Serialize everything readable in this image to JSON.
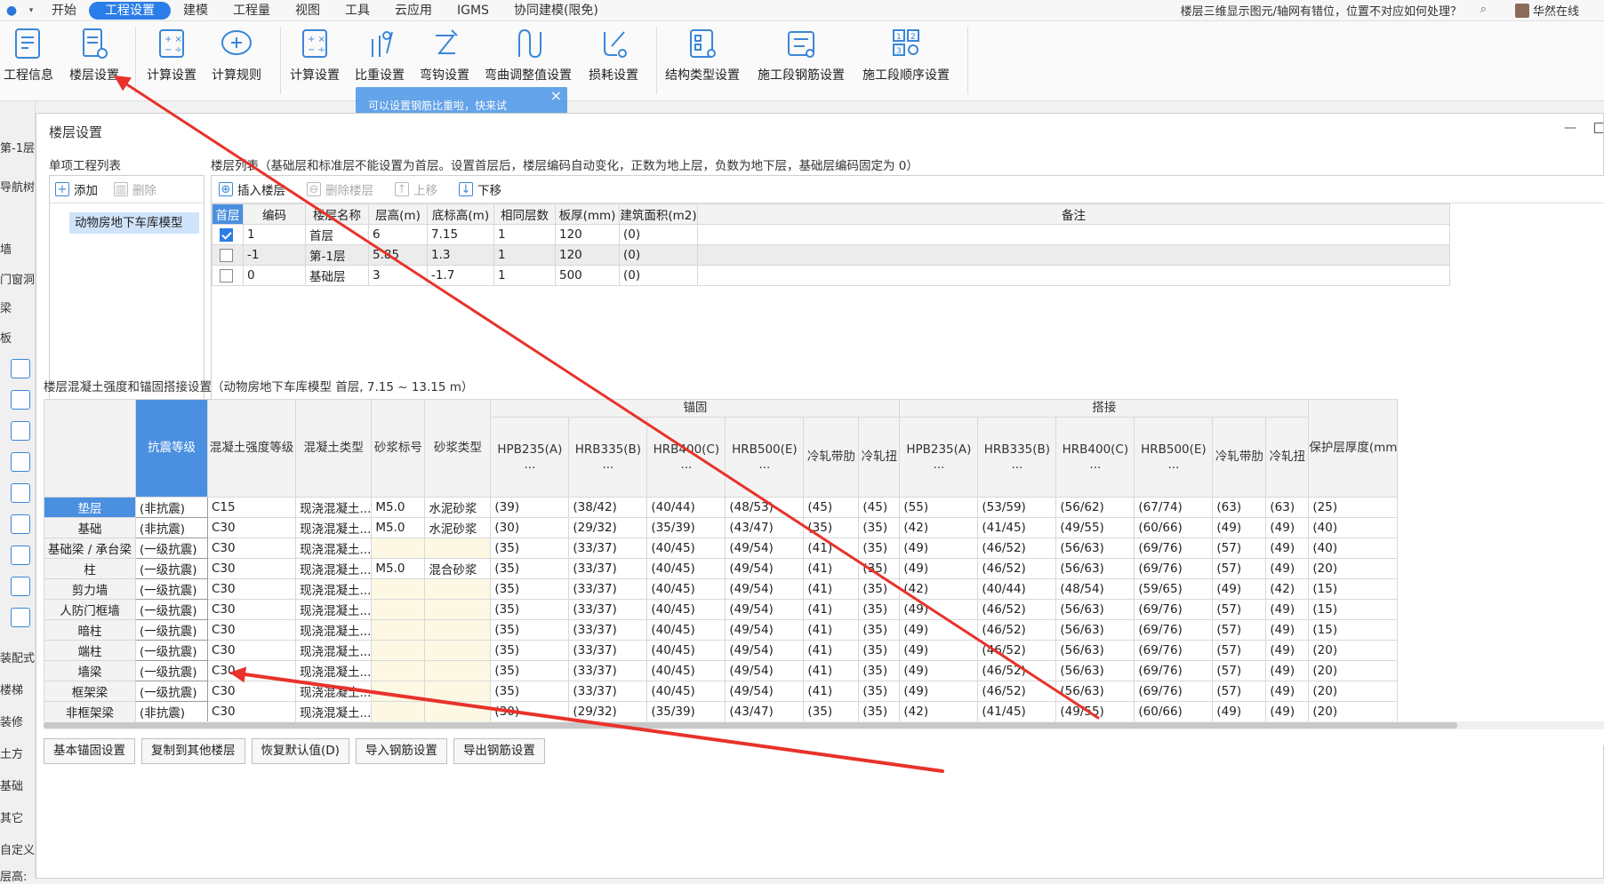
{
  "menu": {
    "items": [
      "开始",
      "工程设置",
      "建模",
      "工程量",
      "视图",
      "工具",
      "云应用",
      "IGMS",
      "协同建模(限免)"
    ],
    "active_index": 1,
    "help_text": "楼层三维显示图元/轴网有错位，位置不对应如何处理？",
    "user": "华然在线"
  },
  "ribbon": {
    "buttons": [
      "工程信息",
      "楼层设置",
      "计算设置",
      "计算规则",
      "计算设置",
      "比重设置",
      "弯钩设置",
      "弯曲调整值设置",
      "损耗设置",
      "结构类型设置",
      "施工段钢筋设置",
      "施工段顺序设置"
    ],
    "tooltip": "可以设置钢筋比重啦，快来试"
  },
  "leftnav": [
    "第-1层",
    "导航树",
    "墙",
    "门窗洞",
    "梁",
    "板",
    "装配式",
    "楼梯",
    "装修",
    "土方",
    "基础",
    "其它",
    "自定义",
    "层高:"
  ],
  "dialog": {
    "title": "楼层设置",
    "project_list_label": "单项工程列表",
    "project_toolbar": [
      "添加",
      "删除"
    ],
    "projects": [
      "动物房地下车库模型"
    ],
    "floor_list_label": "楼层列表（基础层和标准层不能设置为首层。设置首层后，楼层编码自动变化，正数为地上层，负数为地下层，基础层编码固定为 0）",
    "floor_toolbar": [
      "插入楼层",
      "删除楼层",
      "上移",
      "下移"
    ],
    "floor_columns": [
      "首层",
      "编码",
      "楼层名称",
      "层高(m)",
      "底标高(m)",
      "相同层数",
      "板厚(mm)",
      "建筑面积(m2)",
      "备注"
    ],
    "floors": [
      {
        "first": true,
        "code": "1",
        "name": "首层",
        "height": "6",
        "bottom": "7.15",
        "same": "1",
        "thick": "120",
        "area": "(0)",
        "note": ""
      },
      {
        "first": false,
        "code": "-1",
        "name": "第-1层",
        "height": "5.85",
        "bottom": "1.3",
        "same": "1",
        "thick": "120",
        "area": "(0)",
        "note": ""
      },
      {
        "first": false,
        "code": "0",
        "name": "基础层",
        "height": "3",
        "bottom": "-1.7",
        "same": "1",
        "thick": "500",
        "area": "(0)",
        "note": ""
      }
    ],
    "concrete_label": "楼层混凝土强度和锚固搭接设置（动物房地下车库模型 首层, 7.15 ~ 13.15 m）",
    "concrete_headers": {
      "grade": "抗震等级",
      "strength": "混凝土强度等级",
      "ctype": "混凝土类型",
      "mortar_mark": "砂浆标号",
      "mortar_type": "砂浆类型",
      "anchor_group": "锚固",
      "lap_group": "搭接",
      "anchor_cols": [
        "HPB235(A)\n...",
        "HRB335(B)\n...",
        "HRB400(C)\n...",
        "HRB500(E)\n...",
        "冷轧带肋",
        "冷轧扭"
      ],
      "lap_cols": [
        "HPB235(A)\n...",
        "HRB335(B)\n...",
        "HRB400(C)\n...",
        "HRB500(E)\n...",
        "冷轧带肋",
        "冷轧扭"
      ],
      "cover": "保护层厚度(mm"
    },
    "concrete_rows": [
      {
        "name": "垫层",
        "grade": "(非抗震)",
        "strength": "C15",
        "ctype": "现浇混凝土...",
        "mm": "M5.0",
        "mt": "水泥砂浆",
        "anchor": [
          "(39)",
          "(38/42)",
          "(40/44)",
          "(48/53)",
          "(45)",
          "(45)"
        ],
        "lap": [
          "(55)",
          "(53/59)",
          "(56/62)",
          "(67/74)",
          "(63)",
          "(63)"
        ],
        "cover": "(25)"
      },
      {
        "name": "基础",
        "grade": "(非抗震)",
        "strength": "C30",
        "ctype": "现浇混凝土...",
        "mm": "M5.0",
        "mt": "水泥砂浆",
        "anchor": [
          "(30)",
          "(29/32)",
          "(35/39)",
          "(43/47)",
          "(35)",
          "(35)"
        ],
        "lap": [
          "(42)",
          "(41/45)",
          "(49/55)",
          "(60/66)",
          "(49)",
          "(49)"
        ],
        "cover": "(40)"
      },
      {
        "name": "基础梁 / 承台梁",
        "grade": "(一级抗震)",
        "strength": "C30",
        "ctype": "现浇混凝土...",
        "mm": "",
        "mt": "",
        "anchor": [
          "(35)",
          "(33/37)",
          "(40/45)",
          "(49/54)",
          "(41)",
          "(35)"
        ],
        "lap": [
          "(49)",
          "(46/52)",
          "(56/63)",
          "(69/76)",
          "(57)",
          "(49)"
        ],
        "cover": "(40)"
      },
      {
        "name": "柱",
        "grade": "(一级抗震)",
        "strength": "C30",
        "ctype": "现浇混凝土...",
        "mm": "M5.0",
        "mt": "混合砂浆",
        "anchor": [
          "(35)",
          "(33/37)",
          "(40/45)",
          "(49/54)",
          "(41)",
          "(35)"
        ],
        "lap": [
          "(49)",
          "(46/52)",
          "(56/63)",
          "(69/76)",
          "(57)",
          "(49)"
        ],
        "cover": "(20)"
      },
      {
        "name": "剪力墙",
        "grade": "(一级抗震)",
        "strength": "C30",
        "ctype": "现浇混凝土...",
        "mm": "",
        "mt": "",
        "anchor": [
          "(35)",
          "(33/37)",
          "(40/45)",
          "(49/54)",
          "(41)",
          "(35)"
        ],
        "lap": [
          "(42)",
          "(40/44)",
          "(48/54)",
          "(59/65)",
          "(49)",
          "(42)"
        ],
        "cover": "(15)"
      },
      {
        "name": "人防门框墙",
        "grade": "(一级抗震)",
        "strength": "C30",
        "ctype": "现浇混凝土...",
        "mm": "",
        "mt": "",
        "anchor": [
          "(35)",
          "(33/37)",
          "(40/45)",
          "(49/54)",
          "(41)",
          "(35)"
        ],
        "lap": [
          "(49)",
          "(46/52)",
          "(56/63)",
          "(69/76)",
          "(57)",
          "(49)"
        ],
        "cover": "(15)"
      },
      {
        "name": "暗柱",
        "grade": "(一级抗震)",
        "strength": "C30",
        "ctype": "现浇混凝土...",
        "mm": "",
        "mt": "",
        "anchor": [
          "(35)",
          "(33/37)",
          "(40/45)",
          "(49/54)",
          "(41)",
          "(35)"
        ],
        "lap": [
          "(49)",
          "(46/52)",
          "(56/63)",
          "(69/76)",
          "(57)",
          "(49)"
        ],
        "cover": "(15)"
      },
      {
        "name": "端柱",
        "grade": "(一级抗震)",
        "strength": "C30",
        "ctype": "现浇混凝土...",
        "mm": "",
        "mt": "",
        "anchor": [
          "(35)",
          "(33/37)",
          "(40/45)",
          "(49/54)",
          "(41)",
          "(35)"
        ],
        "lap": [
          "(49)",
          "(46/52)",
          "(56/63)",
          "(69/76)",
          "(57)",
          "(49)"
        ],
        "cover": "(20)"
      },
      {
        "name": "墙梁",
        "grade": "(一级抗震)",
        "strength": "C30",
        "ctype": "现浇混凝土...",
        "mm": "",
        "mt": "",
        "anchor": [
          "(35)",
          "(33/37)",
          "(40/45)",
          "(49/54)",
          "(41)",
          "(35)"
        ],
        "lap": [
          "(49)",
          "(46/52)",
          "(56/63)",
          "(69/76)",
          "(57)",
          "(49)"
        ],
        "cover": "(20)"
      },
      {
        "name": "框架梁",
        "grade": "(一级抗震)",
        "strength": "C30",
        "ctype": "现浇混凝土...",
        "mm": "",
        "mt": "",
        "anchor": [
          "(35)",
          "(33/37)",
          "(40/45)",
          "(49/54)",
          "(41)",
          "(35)"
        ],
        "lap": [
          "(49)",
          "(46/52)",
          "(56/63)",
          "(69/76)",
          "(57)",
          "(49)"
        ],
        "cover": "(20)"
      },
      {
        "name": "非框架梁",
        "grade": "(非抗震)",
        "strength": "C30",
        "ctype": "现浇混凝土...",
        "mm": "",
        "mt": "",
        "anchor": [
          "(30)",
          "(29/32)",
          "(35/39)",
          "(43/47)",
          "(35)",
          "(35)"
        ],
        "lap": [
          "(42)",
          "(41/45)",
          "(49/55)",
          "(60/66)",
          "(49)",
          "(49)"
        ],
        "cover": "(20)"
      }
    ],
    "bottom_buttons": [
      "基本锚固设置",
      "复制到其他楼层",
      "恢复默认值(D)",
      "导入钢筋设置",
      "导出钢筋设置"
    ]
  },
  "colors": {
    "accent": "#2b7de9",
    "highlight_header": "#4a8fe0",
    "annotation_arrow": "#e8322a"
  }
}
